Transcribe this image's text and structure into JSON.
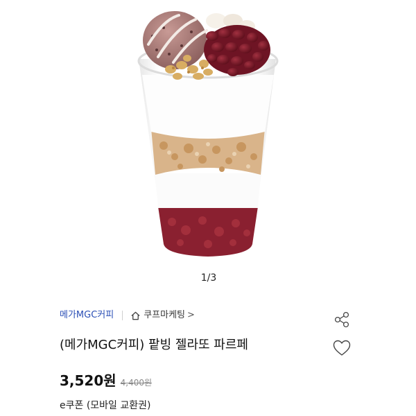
{
  "gallery": {
    "pager": "1/3",
    "image_subject": "parfait-cup"
  },
  "product": {
    "brand_link": "메가MGC커피",
    "shop_link": "쿠프마케팅",
    "shop_chevron": ">",
    "title": "(메가MGC커피) 팥빙 젤라또 파르페",
    "price": "3,520원",
    "original_price": "4,400원",
    "type_label": "e쿠폰 (모바일 교환권)"
  },
  "icons": {
    "shop": "home-icon",
    "share": "share-icon",
    "wishlist": "heart-icon"
  },
  "colors": {
    "brand_link": "#2b4fb6",
    "text": "#111111",
    "muted": "#888888"
  }
}
